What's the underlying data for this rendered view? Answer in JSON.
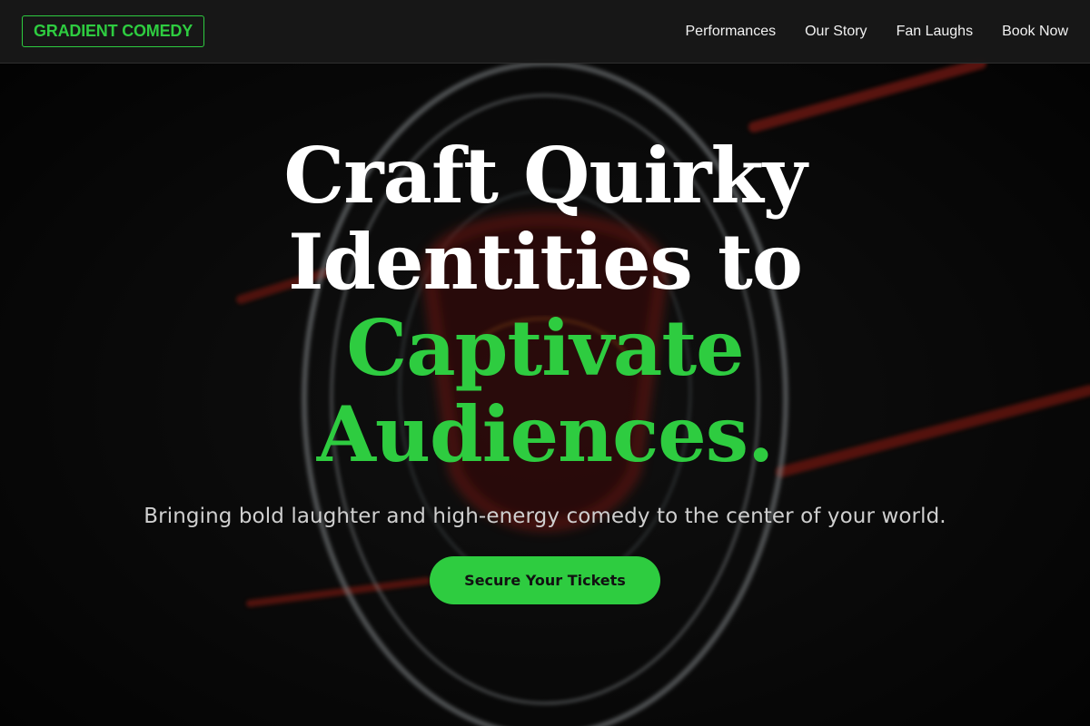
{
  "nav": {
    "logo": "GRADIENT COMEDY",
    "links": [
      "Performances",
      "Our Story",
      "Fan Laughs",
      "Book Now"
    ]
  },
  "hero": {
    "headline_lines": [
      "Craft Quirky",
      "Identities to",
      "Captivate",
      "Audiences."
    ],
    "subtitle": "Bringing bold laughter and high-energy comedy to the center of your world.",
    "cta_label": "Secure Your Tickets"
  },
  "colors": {
    "accent": "#2ecc40",
    "background": "#0b0b0b",
    "nav_bg": "#181818",
    "neon_red": "#c0281a",
    "neon_white": "#cfd6da"
  }
}
